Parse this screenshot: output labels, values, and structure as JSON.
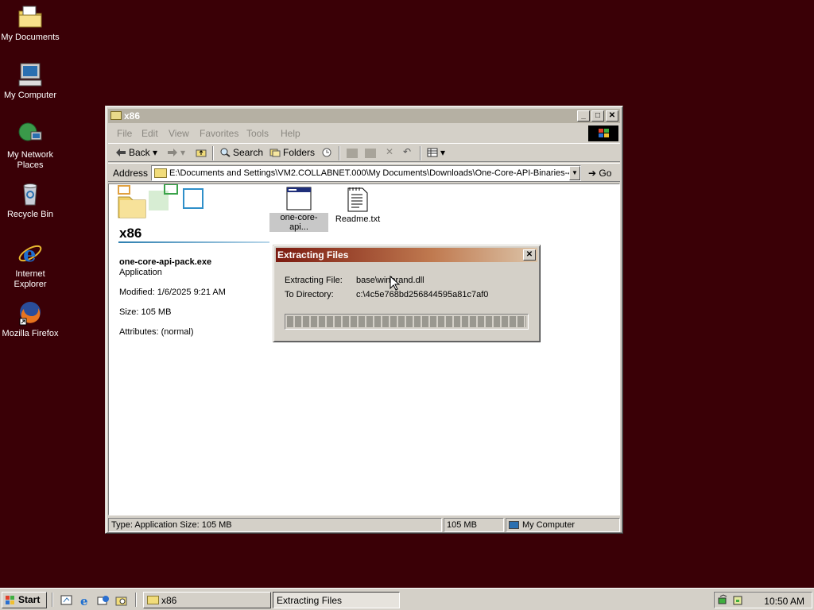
{
  "desktop": {
    "icons": [
      {
        "label": "My Documents",
        "icon": "my-documents-icon"
      },
      {
        "label": "My Computer",
        "icon": "my-computer-icon"
      },
      {
        "label": "My Network Places",
        "icon": "network-places-icon"
      },
      {
        "label": "Recycle Bin",
        "icon": "recycle-bin-icon"
      },
      {
        "label": "Internet Explorer",
        "icon": "internet-explorer-icon"
      },
      {
        "label": "Mozilla Firefox",
        "icon": "firefox-icon"
      }
    ]
  },
  "window": {
    "title": "x86",
    "menu": [
      "File",
      "Edit",
      "View",
      "Favorites",
      "Tools",
      "Help"
    ],
    "toolbar": {
      "back": "Back",
      "search": "Search",
      "folders": "Folders"
    },
    "address_label": "Address",
    "address_value": "E:\\Documents and Settings\\VM2.COLLABNET.000\\My Documents\\Downloads\\One-Core-API-Binaries-4.(",
    "go_label": "Go",
    "left_pane": {
      "folder_title": "x86",
      "selected_name": "one-core-api-pack.exe",
      "selected_type": "Application",
      "modified": "Modified: 1/6/2025 9:21 AM",
      "size": "Size: 105 MB",
      "attributes": "Attributes: (normal)"
    },
    "files": [
      {
        "label": "one-core-api...",
        "icon": "application-icon",
        "selected": true
      },
      {
        "label": "Readme.txt",
        "icon": "text-file-icon",
        "selected": false
      }
    ],
    "status": {
      "info": "Type: Application Size: 105 MB",
      "size": "105 MB",
      "zone": "My Computer"
    }
  },
  "dialog": {
    "title": "Extracting Files",
    "file_label": "Extracting File:",
    "file_value": "base\\winbrand.dll",
    "dir_label": "To Directory:",
    "dir_value": "c:\\4c5e768bd256844595a81c7af0",
    "progress": 1.0
  },
  "taskbar": {
    "start_label": "Start",
    "tasks": [
      {
        "label": "x86",
        "active": false
      },
      {
        "label": "Extracting Files",
        "active": true
      }
    ],
    "clock": "10:50 AM"
  },
  "colors": {
    "desktop": "#3a0006",
    "dialog_title_start": "#7b1a10",
    "window_face": "#d4d0c8"
  }
}
